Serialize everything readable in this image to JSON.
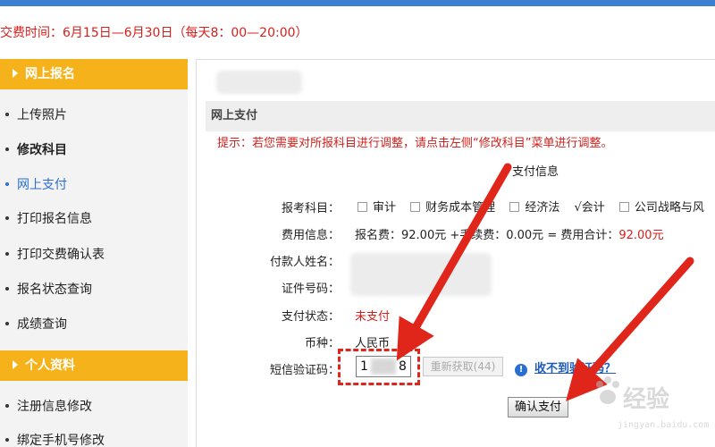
{
  "notice": {
    "text": "交费时间：6月15日—6月30日（每天8：00—20:00）"
  },
  "sidebar": {
    "sections": [
      {
        "title": "网上报名"
      },
      {
        "title": "个人资料"
      }
    ],
    "items": [
      {
        "label": "上传照片"
      },
      {
        "label": "修改科目"
      },
      {
        "label": "网上支付"
      },
      {
        "label": "打印报名信息"
      },
      {
        "label": "打印交费确认表"
      },
      {
        "label": "报名状态查询"
      },
      {
        "label": "成绩查询"
      },
      {
        "label": "注册信息修改"
      },
      {
        "label": "绑定手机号修改"
      }
    ]
  },
  "main": {
    "section_title": "网上支付",
    "hint": "提示：若您需要对所报科目进行调整，请点击左侧“修改科目”菜单进行调整。",
    "payment_title": "支付信息",
    "form": {
      "subjects_label": "报考科目：",
      "subjects": [
        {
          "label": "审计",
          "mark": ""
        },
        {
          "label": "财务成本管理",
          "mark": ""
        },
        {
          "label": "经济法",
          "mark": ""
        },
        {
          "label": "会计",
          "mark": "√"
        },
        {
          "label": "公司战略与风",
          "mark": ""
        }
      ],
      "fee_label": "费用信息：",
      "fee_text": "报名费：92.00元 +手续费：0.00元 = 费用合计：",
      "fee_total": "92.00元",
      "payer_label": "付款人姓名：",
      "id_label": "证件号码：",
      "status_label": "支付状态：",
      "status_value": "未支付",
      "currency_label": "币种：",
      "currency_value": "人民币",
      "sms_label": "短信验证码：",
      "sms_value_start": "1",
      "sms_value_end": "8",
      "resend_label": "重新获取(44)",
      "help_link": "收不到验证码？",
      "confirm_label": "确认支付"
    }
  },
  "watermark": {
    "brand": "经验",
    "url": "jingyan.baidu.com"
  },
  "colors": {
    "accent_orange": "#f6b21a",
    "link_blue": "#2a6fcf",
    "alert_red": "#d4201c",
    "annotation_red": "#e0251b"
  },
  "icons": {
    "help": "info-circle-icon",
    "section": "triangle-right-icon"
  }
}
